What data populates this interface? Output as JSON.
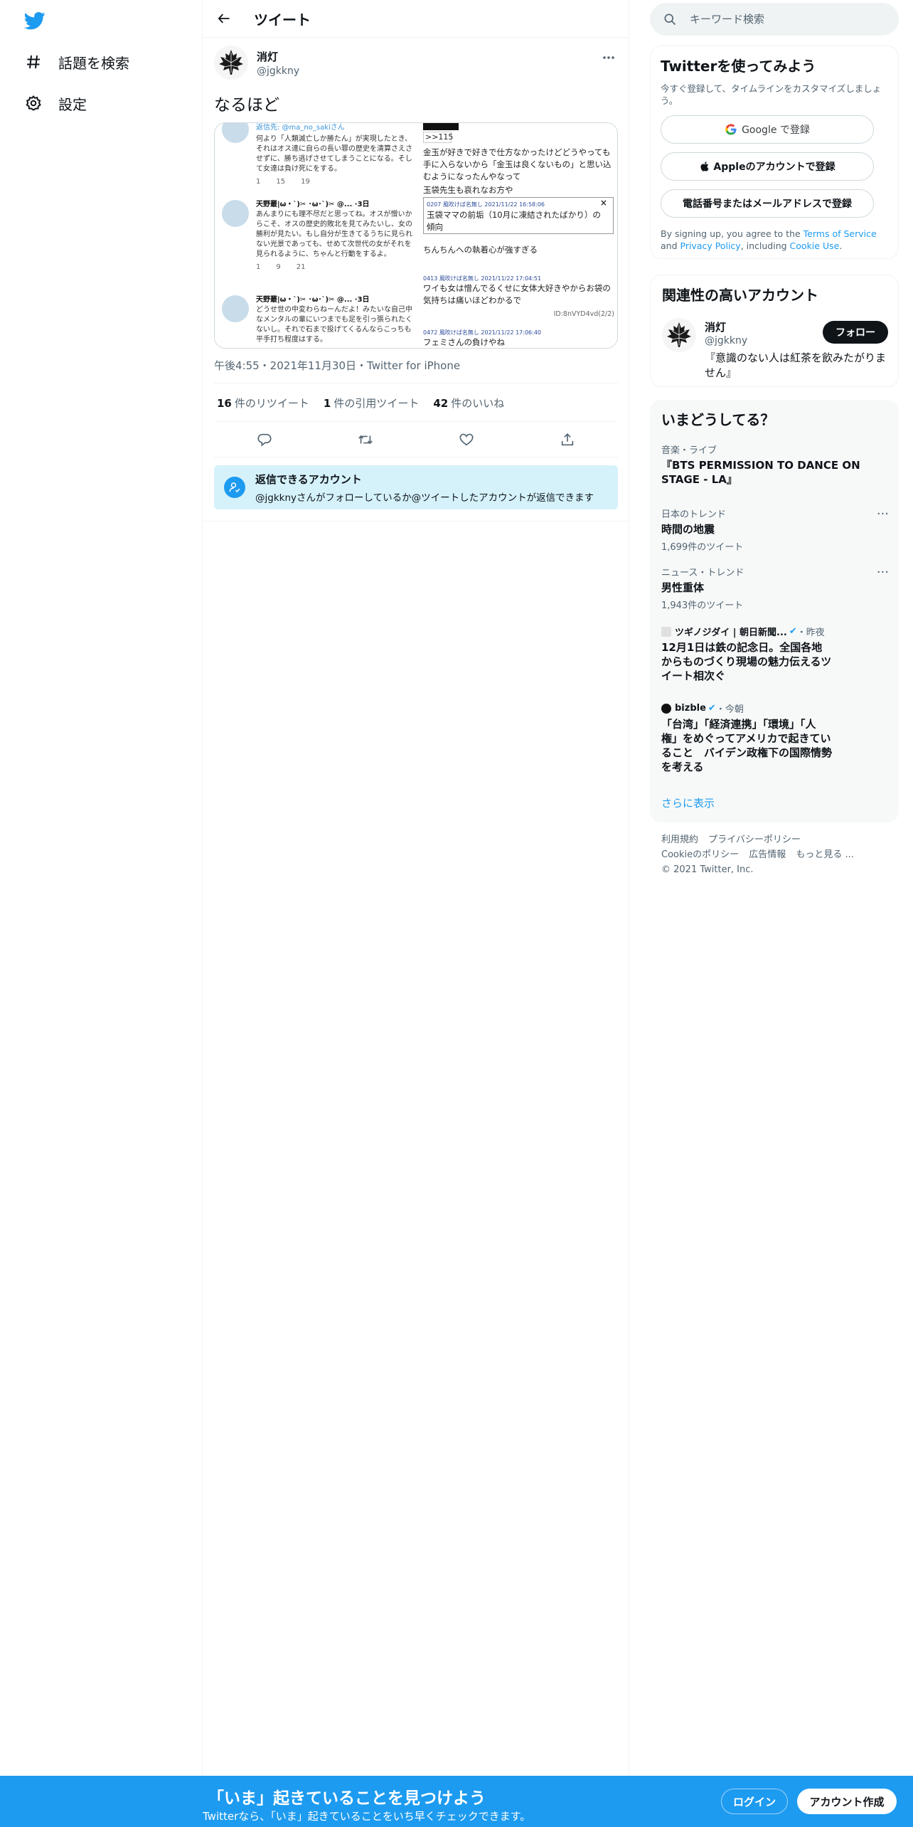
{
  "nav": {
    "explore": "話題を検索",
    "settings": "設定"
  },
  "header": {
    "title": "ツイート"
  },
  "tweet": {
    "display_name": "消灯",
    "username": "@jgkkny",
    "text": "なるほど",
    "timestamp": "午後4:55・2021年11月30日・Twitter for iPhone",
    "retweets": {
      "count": "16",
      "label": "件のリツイート"
    },
    "quotes": {
      "count": "1",
      "label": "件の引用ツイート"
    },
    "likes": {
      "count": "42",
      "label": "件のいいね"
    }
  },
  "media": {
    "left": {
      "reply_to": "返信先: @ma_no_sakiさん",
      "t1_text": [
        "何より「人類滅亡しか勝たん」が実現したとき、それはオス達に自らの長い罪の歴史を清算さえさせずに、勝ち逃げさせてしまうことになる。そして女達は負け死にをする。"
      ],
      "t1_counts": [
        "1",
        "15",
        "19"
      ],
      "t2_name": "天野叢|ω・`)✂︎ ･ω･`)✂︎ @... ·3日",
      "t2_text": "あんまりにも理不尽だと思ってね。オスが憎いからこそ、オスの歴史的敗北を見てみたいし、女の勝利が見たい。もし自分が生きてるうちに見られない光景であっても、せめて次世代の女がそれを見られるように、ちゃんと行動をするよ。",
      "t2_counts": [
        "1",
        "9",
        "21"
      ],
      "t3_name": "天野叢|ω・`)✂︎ ･ω･`)✂︎ @... ·3日",
      "t3_text": "どうせ世の中変わらねーんだよ！みたいな自己中なメンタルの輩にいつまでも足を引っ張られたくないし。それで石まで投げてくるんならこっちも平手打ち程度はする。"
    },
    "right": {
      "anchor": ">>115",
      "l1": "金玉が好きで好きで仕方なかったけどどうやっても手に入らないから「金玉は良くないもの」と思い込むようになったんやなって",
      "l2": "玉袋先生も哀れなお方や",
      "meta1": "0207 風吹けば名無し 2021/11/22 16:58:06",
      "l3": "玉袋ママの前垢（10月に凍結されたばかり）の傾向",
      "l4": "ちんちんへの執着心が強すぎる",
      "meta2": "0413 風吹けば名無し 2021/11/22 17:04:51",
      "l5": "ワイも女は憎んでるくせに女体大好きやからお袋の気持ちは痛いほどわかるで",
      "id1": "ID:8nVYD4vd(2/2)",
      "meta3": "0472 風吹けば名無し 2021/11/22 17:06:40",
      "l6": "フェミさんの負けやね"
    }
  },
  "reply_settings": {
    "title": "返信できるアカウント",
    "subtitle": "@jgkknyさんがフォローしているか@ツイートしたアカウントが返信できます"
  },
  "search": {
    "placeholder": "キーワード検索"
  },
  "signup_card": {
    "title": "Twitterを使ってみよう",
    "subtitle": "今すぐ登録して、タイムラインをカスタマイズしましょう。",
    "google": "Google で登録",
    "apple": "Appleのアカウントで登録",
    "phone": "電話番号またはメールアドレスで登録",
    "terms_prefix": "By signing up, you agree to the ",
    "terms_link": "Terms of Service",
    "terms_mid": " and ",
    "privacy_link": "Privacy Policy",
    "terms_mid2": ", including ",
    "cookie_link": "Cookie Use",
    "terms_end": "."
  },
  "related": {
    "title": "関連性の高いアカウント",
    "name": "消灯",
    "username": "@jgkkny",
    "follow": "フォロー",
    "bio": "『意識のない人は紅茶を飲みたがりません』"
  },
  "trends": {
    "title": "いまどうしてる？",
    "items": [
      {
        "category": "音楽・ライブ",
        "title": "『BTS PERMISSION TO DANCE ON STAGE - LA』",
        "count": ""
      },
      {
        "category": "日本のトレンド",
        "title": "時間の地震",
        "count": "1,699件のツイート"
      },
      {
        "category": "ニュース・トレンド",
        "title": "男性重体",
        "count": "1,943件のツイート"
      }
    ],
    "news": [
      {
        "source": "ツギノジダイ | 朝日新聞...",
        "time": "・昨夜",
        "title": "12月1日は鉄の記念日。全国各地からものづくり現場の魅力伝えるツイート相次ぐ"
      },
      {
        "source": "bizble",
        "time": "・今朝",
        "title": "「台湾」「経済連携」「環境」「人権」をめぐってアメリカで起きていること　バイデン政権下の国際情勢を考える"
      }
    ],
    "show_more": "さらに表示"
  },
  "footer": {
    "terms": "利用規約",
    "privacy": "プライバシーポリシー",
    "cookie": "Cookieのポリシー",
    "ads": "広告情報",
    "more": "もっと見る ...",
    "copyright": "© 2021 Twitter, Inc."
  },
  "banner": {
    "title": "「いま」起きていることを見つけよう",
    "subtitle": "Twitterなら、「いま」起きていることをいち早くチェックできます。",
    "login": "ログイン",
    "signup": "アカウント作成"
  },
  "colors": {
    "accent": "#1d9bf0",
    "text": "#0f1419",
    "secondary": "#536471",
    "reply_bg": "#d5f2fb"
  }
}
